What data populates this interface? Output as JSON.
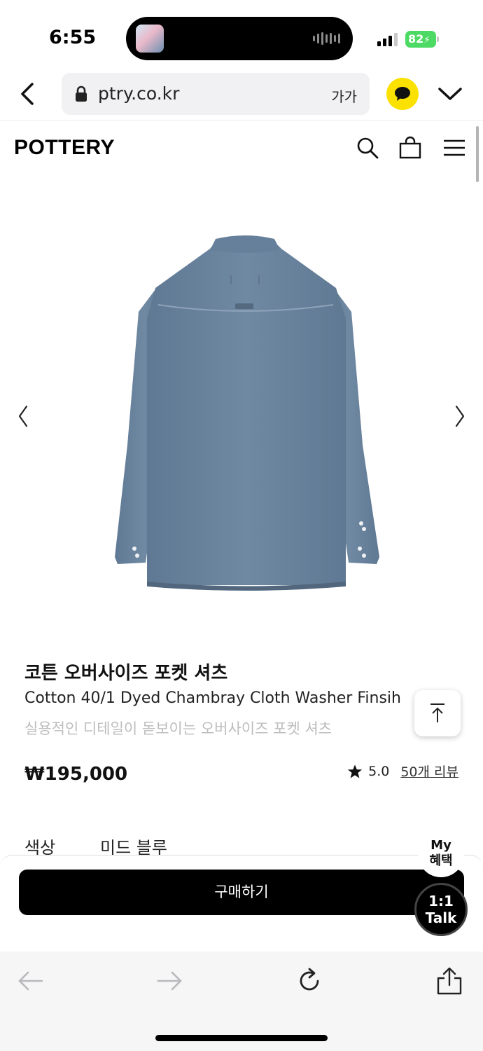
{
  "status_bar": {
    "time": "6:55",
    "battery": "82"
  },
  "browser": {
    "url": "ptry.co.kr",
    "text_size_label": "가가"
  },
  "site": {
    "logo": "POTTERY"
  },
  "product": {
    "name_ko": "코튼 오버사이즈 포켓 셔츠",
    "name_en": "Cotton 40/1 Dyed Chambray Cloth Washer Finsih",
    "description": "실용적인 디테일이 돋보이는 오버사이즈 포켓 셔츠",
    "price": "₩195,000",
    "rating": "5.0",
    "review_count": "50개 리뷰",
    "color_label": "색상",
    "color_value": "미드 블루",
    "shirt_color": "#6d86a0"
  },
  "actions": {
    "buy_label": "구매하기",
    "my_benefit_line1": "My",
    "my_benefit_line2": "혜택",
    "chat_line1": "1:1",
    "chat_line2": "Talk"
  },
  "colors": {
    "kakao_yellow": "#fae100",
    "battery_green": "#4cd964",
    "buy_button": "#000000"
  }
}
